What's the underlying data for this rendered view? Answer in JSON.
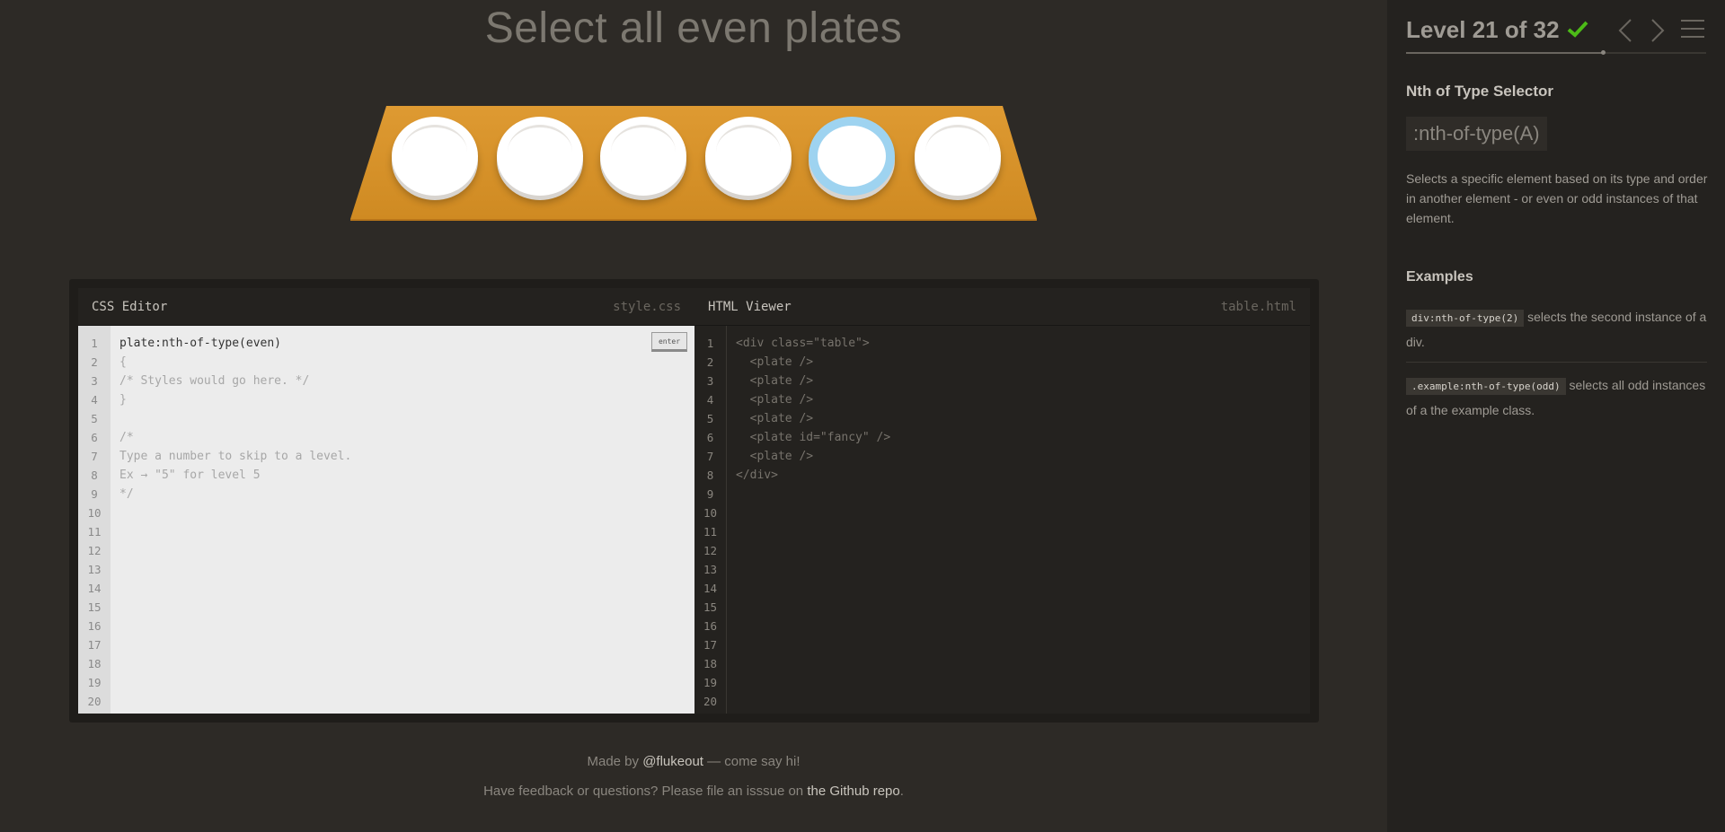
{
  "title": "Select all even plates",
  "table": {
    "plates": [
      {
        "id": "",
        "fancy": false
      },
      {
        "id": "",
        "fancy": false
      },
      {
        "id": "",
        "fancy": false
      },
      {
        "id": "",
        "fancy": false
      },
      {
        "id": "fancy",
        "fancy": true
      },
      {
        "id": "",
        "fancy": false
      }
    ]
  },
  "css_editor": {
    "title": "CSS Editor",
    "filename": "style.css",
    "input_value": "plate:nth-of-type(even)",
    "lines": [
      "{",
      "/* Styles would go here. */",
      "}",
      "",
      "/*",
      "Type a number to skip to a level.",
      "Ex → \"5\" for level 5",
      "*/"
    ],
    "enter_label": "enter",
    "line_count": 20
  },
  "html_viewer": {
    "title": "HTML Viewer",
    "filename": "table.html",
    "lines": [
      "<div class=\"table\">",
      "  <plate />",
      "  <plate />",
      "  <plate />",
      "  <plate />",
      "  <plate id=\"fancy\" />",
      "  <plate />",
      "</div>"
    ],
    "line_count": 20
  },
  "footer": {
    "made_by_prefix": "Made by ",
    "made_by_link": "@flukeout",
    "made_by_suffix": " — come say hi!",
    "feedback_prefix": "Have feedback or questions? Please file an isssue on ",
    "feedback_link": "the Github repo",
    "feedback_suffix": "."
  },
  "sidebar": {
    "level_text": "Level 21 of 32",
    "completed": true,
    "progress": 0.656,
    "selector_name": "Nth of Type Selector",
    "syntax": ":nth-of-type(A)",
    "description": "Selects a specific element based on its type and order in another element - or even or odd instances of that element.",
    "examples_title": "Examples",
    "examples": [
      {
        "code": "div:nth-of-type(2)",
        "text": " selects the second instance of a div."
      },
      {
        "code": ".example:nth-of-type(odd)",
        "text": " selects all odd instances of a the example class."
      }
    ]
  },
  "icons": {
    "check": "checkmark-icon",
    "prev": "chevron-left-icon",
    "next": "chevron-right-icon",
    "menu": "hamburger-menu-icon"
  },
  "colors": {
    "background": "#2d2a26",
    "sidebar": "#24221f",
    "table_wood": "#e09a2c",
    "fancy_plate_ring": "#9ed3f0",
    "check": "#4cbb17"
  }
}
